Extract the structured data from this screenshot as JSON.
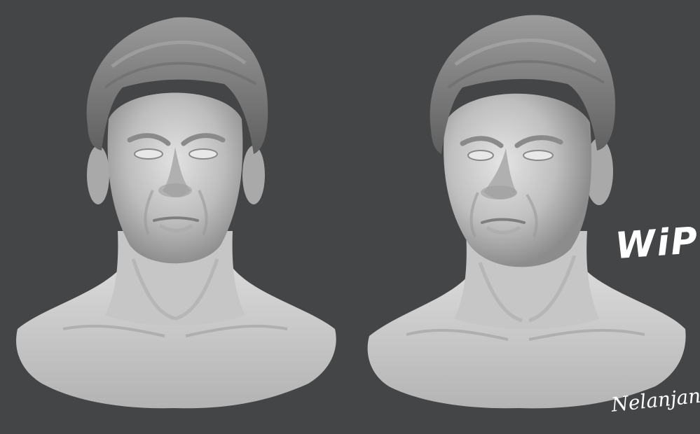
{
  "image": {
    "background_color": "#444546",
    "subject": "digital sculpt of a male head and shoulders bust, shown front and three-quarter view",
    "overlay_text": {
      "wip": "WiP",
      "signature": "Nelanjan Rey"
    }
  }
}
